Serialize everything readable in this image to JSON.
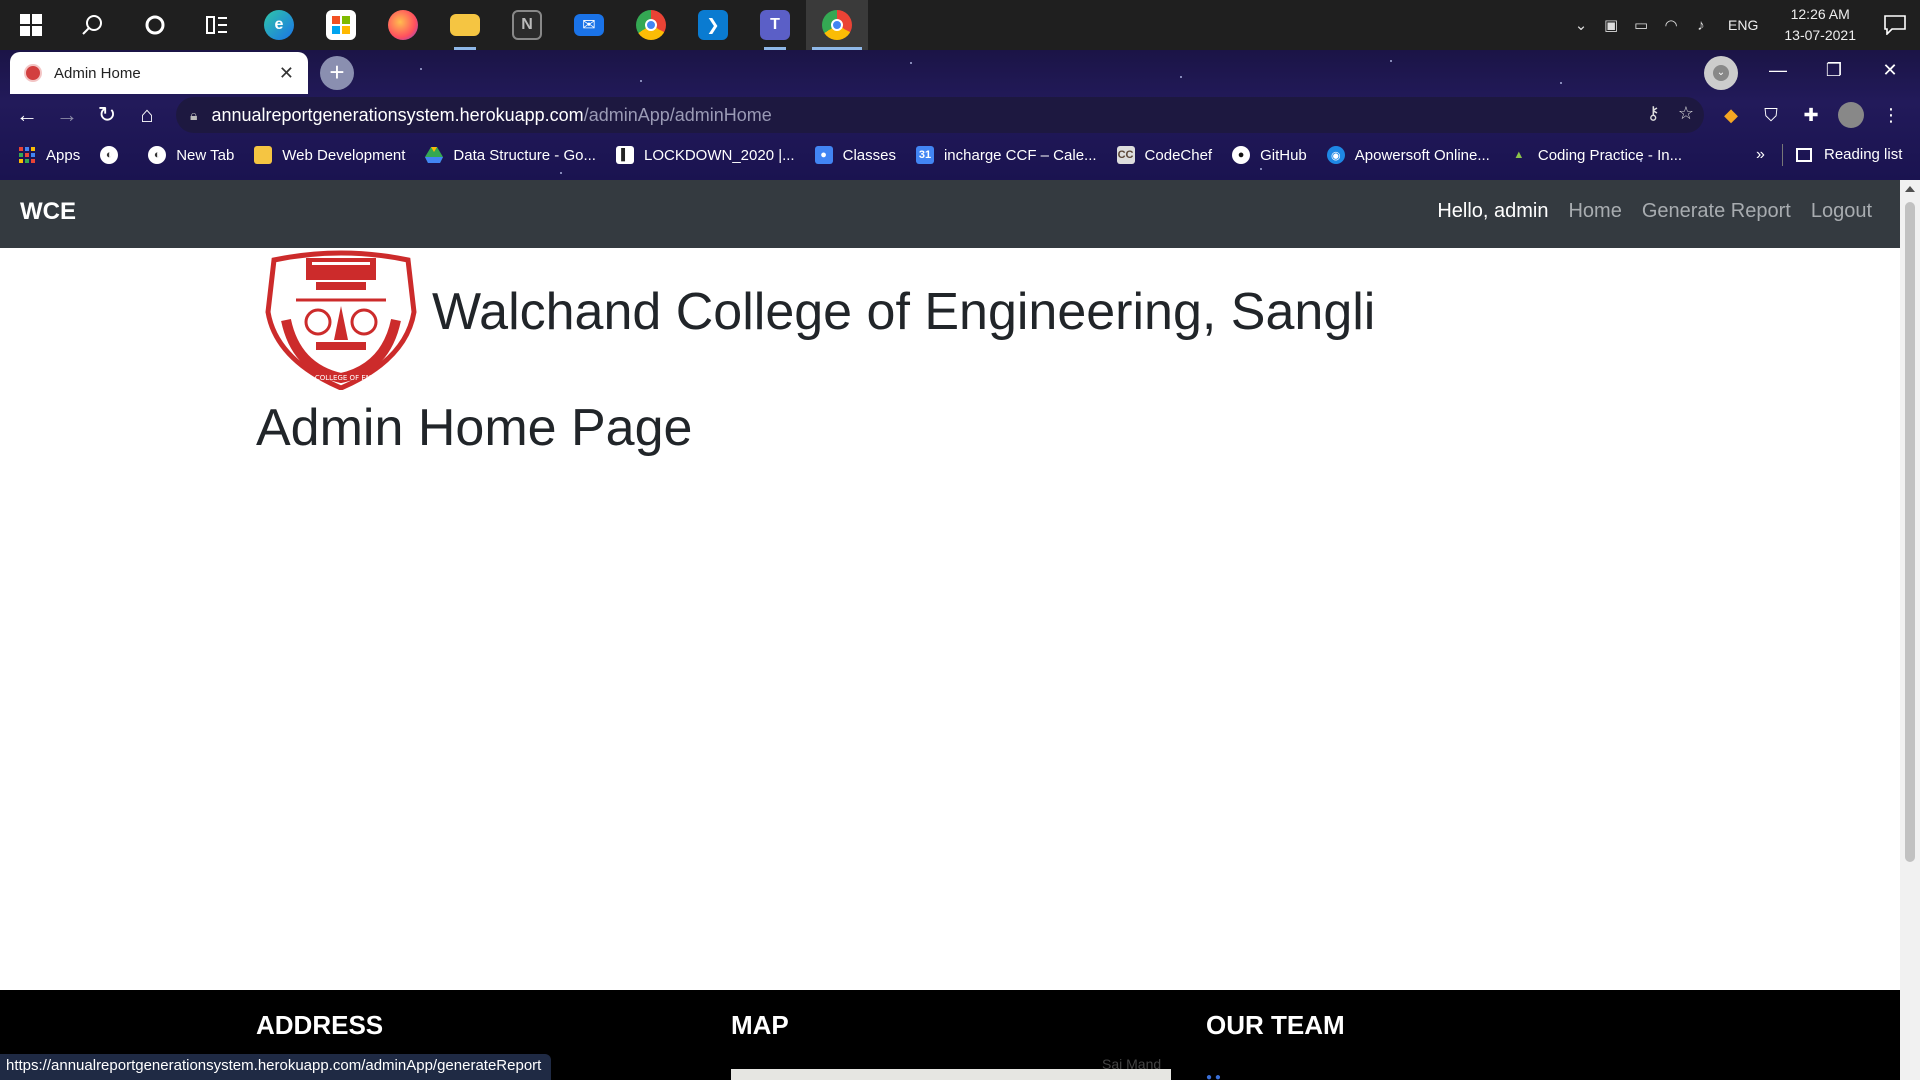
{
  "taskbar": {
    "apps": [
      {
        "name": "start",
        "glyph": "⊞"
      },
      {
        "name": "search",
        "glyph": "⌕"
      },
      {
        "name": "cortana",
        "glyph": "○"
      },
      {
        "name": "task-view",
        "glyph": "▤"
      },
      {
        "name": "edge",
        "glyph": "e"
      },
      {
        "name": "store",
        "glyph": "▦"
      },
      {
        "name": "firefox",
        "glyph": "◉"
      },
      {
        "name": "file-explorer",
        "glyph": "▬"
      },
      {
        "name": "notion",
        "glyph": "N"
      },
      {
        "name": "mail",
        "glyph": "✉"
      },
      {
        "name": "chrome",
        "glyph": "◎"
      },
      {
        "name": "vscode",
        "glyph": "❯"
      },
      {
        "name": "teams",
        "glyph": "T"
      },
      {
        "name": "chrome-active",
        "glyph": "◎"
      }
    ],
    "language": "ENG",
    "time": "12:26 AM",
    "date": "13-07-2021"
  },
  "browser": {
    "tab_title": "Admin Home",
    "tab_close": "✕",
    "new_tab": "+",
    "url_host": "annualreportgenerationsystem.herokuapp.com",
    "url_path": "/adminApp/adminHome",
    "bookmarks": [
      {
        "label": "Apps",
        "color": "#e94235"
      },
      {
        "label": "",
        "color": "#555"
      },
      {
        "label": "New Tab",
        "color": "#555"
      },
      {
        "label": "Web Development",
        "color": "#f5c542"
      },
      {
        "label": "Data Structure - Go...",
        "color": "#34a853"
      },
      {
        "label": "LOCKDOWN_2020 |...",
        "color": "#222"
      },
      {
        "label": "Classes",
        "color": "#4285f4"
      },
      {
        "label": "incharge CCF – Cale...",
        "color": "#4285f4"
      },
      {
        "label": "CodeChef",
        "color": "#6b4f3a"
      },
      {
        "label": "GitHub",
        "color": "#222"
      },
      {
        "label": "Apowersoft Online...",
        "color": "#1e88e5"
      },
      {
        "label": "Coding Practice - In...",
        "color": "#2e7d32"
      }
    ],
    "bookmarks_more": "»",
    "reading_list": "Reading list",
    "status_url": "https://annualreportgenerationsystem.herokuapp.com/adminApp/generateReport"
  },
  "page": {
    "brand": "WCE",
    "greeting": "Hello, admin",
    "nav": {
      "home": "Home",
      "generate_report": "Generate Report",
      "logout": "Logout"
    },
    "college_name": "Walchand College of Engineering, Sangli",
    "logo_text": "WALCHAND COLLEGE OF ENGINEERING",
    "heading": "Admin Home Page",
    "footer": {
      "address": "ADDRESS",
      "map": "MAP",
      "our_team": "OUR TEAM",
      "map_label": "Sai Mand"
    }
  }
}
